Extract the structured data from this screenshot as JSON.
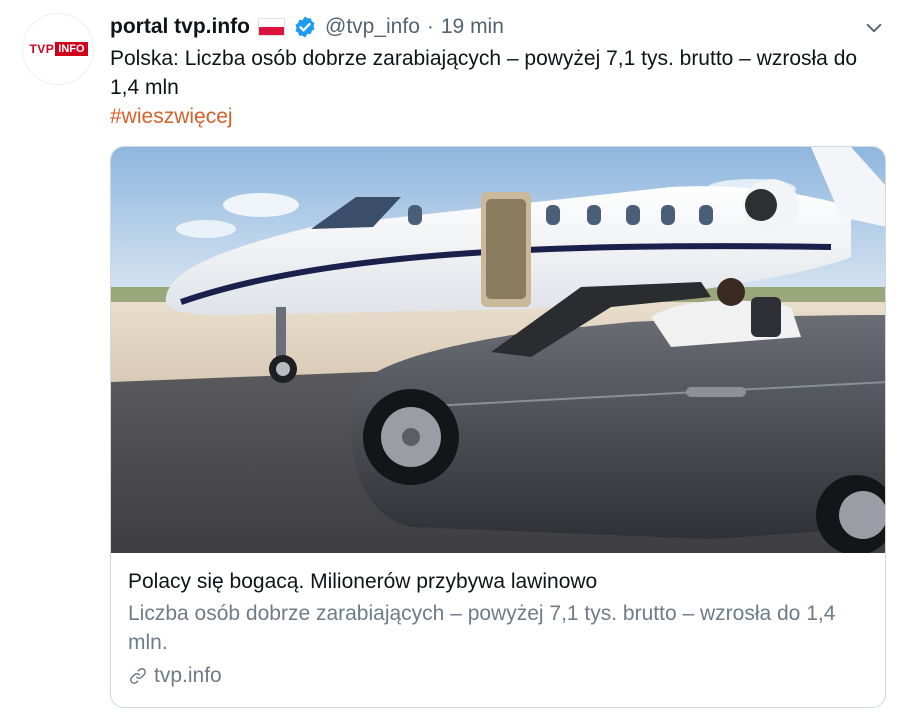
{
  "tweet": {
    "avatar_logo": {
      "left": "TVP",
      "right": "INFO"
    },
    "author_name": "portal tvp.info",
    "flag": "polish-flag-icon",
    "verified": "verified-badge-icon",
    "handle": "@tvp_info",
    "separator": "·",
    "time": "19 min",
    "text": "Polska: Liczba osób dobrze zarabiających – powyżej 7,1 tys. brutto – wzrosła do 1,4 mln",
    "hashtag": "#wieszwięcej"
  },
  "card": {
    "image": "private-jet-and-convertible-car-photo",
    "title": "Polacy się bogacą. Milionerów przybywa lawinowo",
    "description": "Liczba osób dobrze zarabiających – powyżej 7,1 tys. brutto – wzrosła do 1,4 mln.",
    "domain": "tvp.info",
    "link_icon": "link-icon"
  },
  "colors": {
    "hashtag": "#d4612c",
    "secondary_text": "#536471",
    "verified": "#1d9bf0",
    "brand_red": "#d0021b"
  }
}
